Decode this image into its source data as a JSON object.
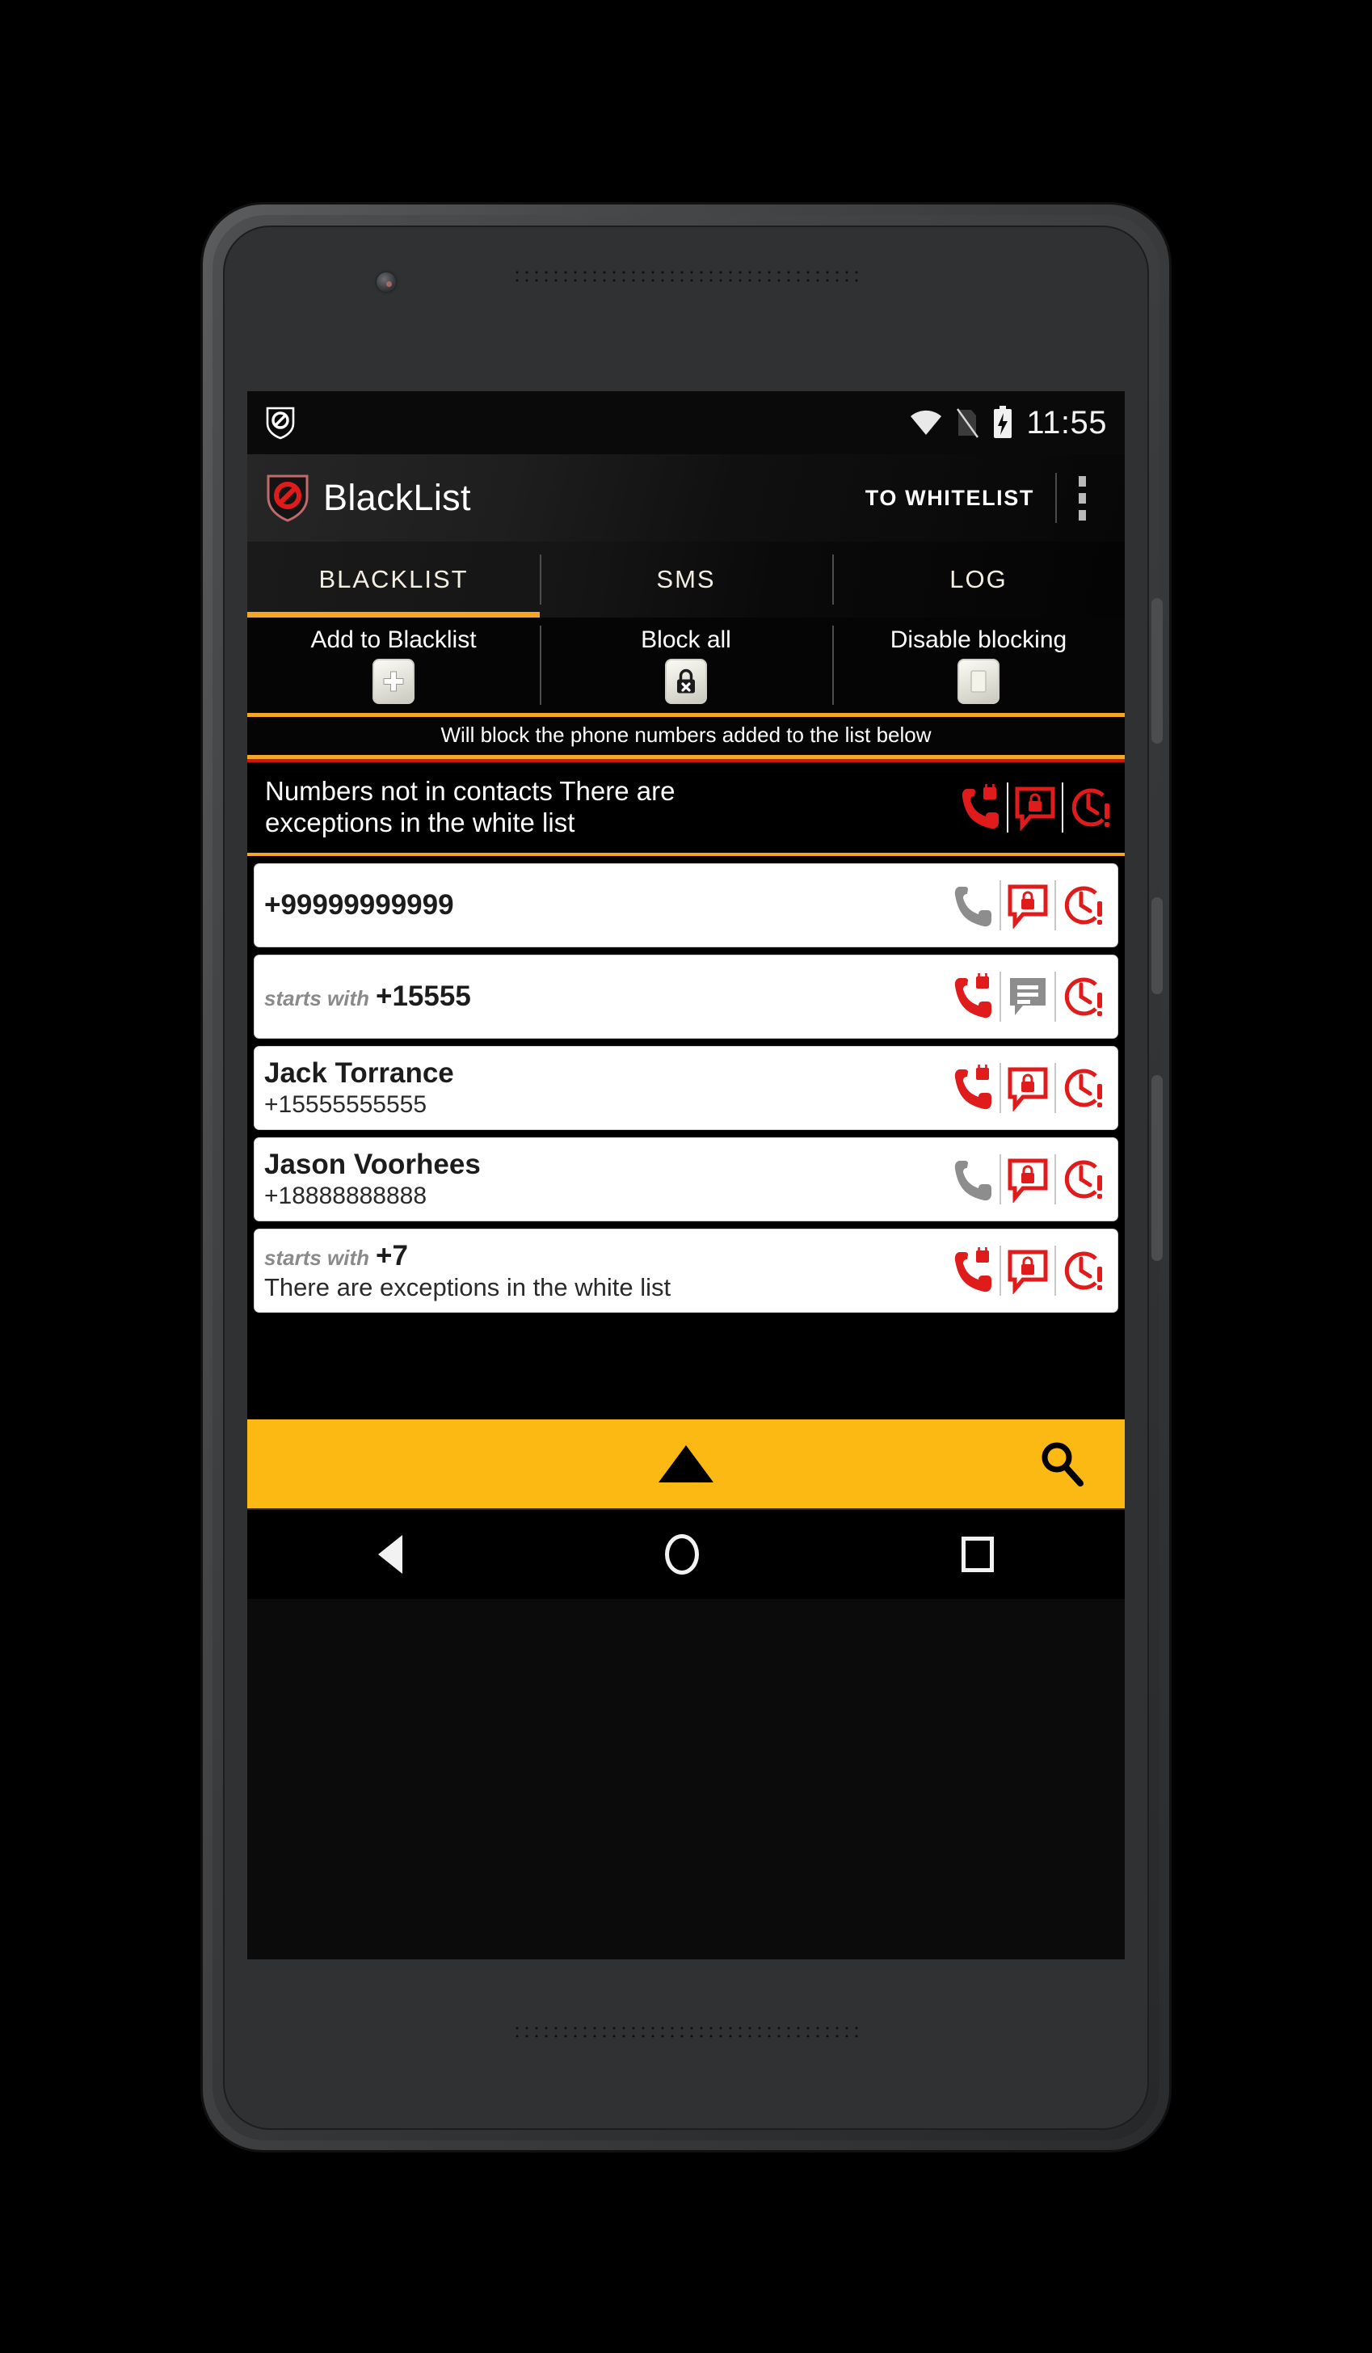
{
  "statusbar": {
    "app_icon": "blocked-shield-icon",
    "wifi_icon": "wifi-icon",
    "sim_icon": "no-sim-icon",
    "battery_icon": "battery-charging-icon",
    "time": "11:55"
  },
  "appbar": {
    "logo_icon": "blacklist-shield-icon",
    "title": "BlackList",
    "to_whitelist_label": "TO WHITELIST",
    "overflow_icon": "more-vertical-icon"
  },
  "tabs": [
    {
      "label": "BLACKLIST",
      "active": true
    },
    {
      "label": "SMS",
      "active": false
    },
    {
      "label": "LOG",
      "active": false
    }
  ],
  "quick_actions": [
    {
      "label": "Add to Blacklist",
      "icon": "plus-icon"
    },
    {
      "label": "Block all",
      "icon": "lock-x-icon"
    },
    {
      "label": "Disable blocking",
      "icon": "blank-square-icon"
    }
  ],
  "hint": "Will block the phone numbers added to the list below",
  "list": [
    {
      "style": "dark",
      "prefix": "",
      "primary": "Numbers not in contacts There are",
      "secondary": "exceptions in the white list",
      "call_icon": "phone-locked-icon",
      "call_state": "blocked",
      "sms_icon": "sms-locked-icon",
      "sms_state": "blocked",
      "schedule_icon": "clock-alert-icon",
      "schedule_state": "blocked"
    },
    {
      "style": "white",
      "prefix": "",
      "primary": "+99999999999",
      "secondary": "",
      "call_icon": "phone-icon",
      "call_state": "allowed",
      "sms_icon": "sms-locked-icon",
      "sms_state": "blocked",
      "schedule_icon": "clock-alert-icon",
      "schedule_state": "blocked"
    },
    {
      "style": "white",
      "prefix": "starts with",
      "primary": "+15555",
      "secondary": "",
      "call_icon": "phone-locked-icon",
      "call_state": "blocked",
      "sms_icon": "sms-icon",
      "sms_state": "allowed",
      "schedule_icon": "clock-alert-icon",
      "schedule_state": "blocked"
    },
    {
      "style": "white",
      "prefix": "",
      "primary": "Jack Torrance",
      "secondary": "+15555555555",
      "call_icon": "phone-locked-icon",
      "call_state": "blocked",
      "sms_icon": "sms-locked-icon",
      "sms_state": "blocked",
      "schedule_icon": "clock-alert-icon",
      "schedule_state": "blocked"
    },
    {
      "style": "white",
      "prefix": "",
      "primary": "Jason Voorhees",
      "secondary": "+18888888888",
      "call_icon": "phone-icon",
      "call_state": "allowed",
      "sms_icon": "sms-locked-icon",
      "sms_state": "blocked",
      "schedule_icon": "clock-alert-icon",
      "schedule_state": "blocked"
    },
    {
      "style": "white",
      "prefix": "starts with",
      "primary": "+7",
      "secondary": "There are exceptions in the white list",
      "call_icon": "phone-locked-icon",
      "call_state": "blocked",
      "sms_icon": "sms-locked-icon",
      "sms_state": "blocked",
      "schedule_icon": "clock-alert-icon",
      "schedule_state": "blocked"
    }
  ],
  "bottombar": {
    "scroll_top_icon": "caret-up-icon",
    "search_icon": "search-icon"
  },
  "navbar": {
    "back_icon": "back-triangle-icon",
    "home_icon": "home-circle-icon",
    "recents_icon": "recents-square-icon"
  },
  "colors": {
    "accent_yellow": "#fcb913",
    "accent_orange": "#f5a623",
    "blocked_red": "#e01b1b",
    "allowed_gray": "#8d8d8d",
    "screen_black": "#000000"
  }
}
